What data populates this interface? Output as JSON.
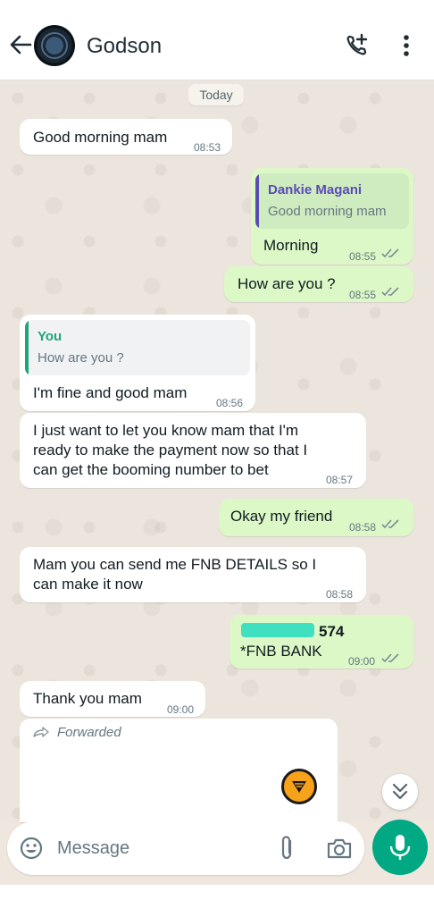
{
  "header": {
    "contact_name": "Godson"
  },
  "chat": {
    "date_chip": "Today",
    "messages": [
      {
        "text": "Good morning mam",
        "time": "08:53"
      },
      {
        "quote_name": "Dankie Magani",
        "quote_text": "Good morning mam",
        "text": "Morning",
        "time": "08:55"
      },
      {
        "text": "How are you ?",
        "time": "08:55"
      },
      {
        "quote_name": "You",
        "quote_text": "How are you ?",
        "text": "I'm fine and good mam",
        "time": "08:56"
      },
      {
        "text": "I just want to let you know mam that I'm\nready to make the payment now so that I\ncan get the booming number to bet",
        "time": "08:57"
      },
      {
        "text": "Okay my friend",
        "time": "08:58"
      },
      {
        "text": "Mam you can send me FNB DETAILS so I\ncan make it now",
        "time": "08:58"
      },
      {
        "account_suffix": "574",
        "bank": "*FNB BANK",
        "time": "09:00"
      },
      {
        "text": "Thank you mam",
        "time": "09:00"
      }
    ],
    "forwarded_label": "Forwarded"
  },
  "composer": {
    "placeholder": "Message"
  },
  "colors": {
    "incoming_bubble": "#ffffff",
    "outgoing_bubble": "#dcf8c6",
    "accent_green": "#00a884",
    "quote_purple": "#5b4bb7",
    "quote_teal": "#1fa57a",
    "fnb_orange": "#f7a21b"
  },
  "icons": {
    "back": "arrow-left-icon",
    "call": "add-call-icon",
    "menu": "vertical-dots-icon",
    "read": "double-check-icon",
    "forward": "forward-arrow-icon",
    "bank": "fnb-logo-icon",
    "scroll": "chevron-double-down-icon",
    "emoji": "emoji-icon",
    "attach": "paperclip-icon",
    "camera": "camera-icon",
    "mic": "microphone-icon"
  }
}
